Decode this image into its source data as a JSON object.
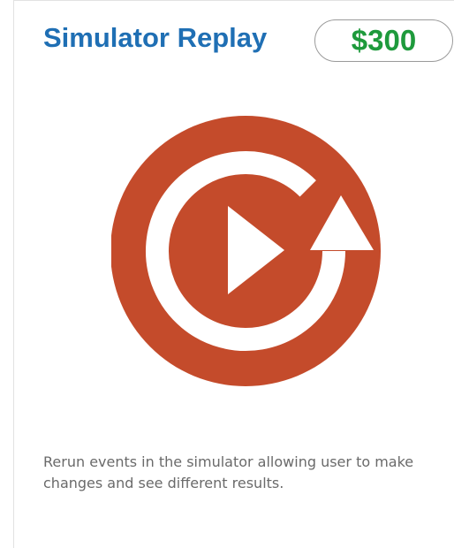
{
  "card": {
    "title": "Simulator Replay",
    "price": "$300",
    "icon": "replay-play-icon",
    "description": "Rerun events in the simulator allowing user to make changes and see different results."
  },
  "colors": {
    "title": "#1f6fb4",
    "price": "#1e9a3c",
    "icon_fill": "#c44b2b",
    "description": "#6a6a6a"
  }
}
